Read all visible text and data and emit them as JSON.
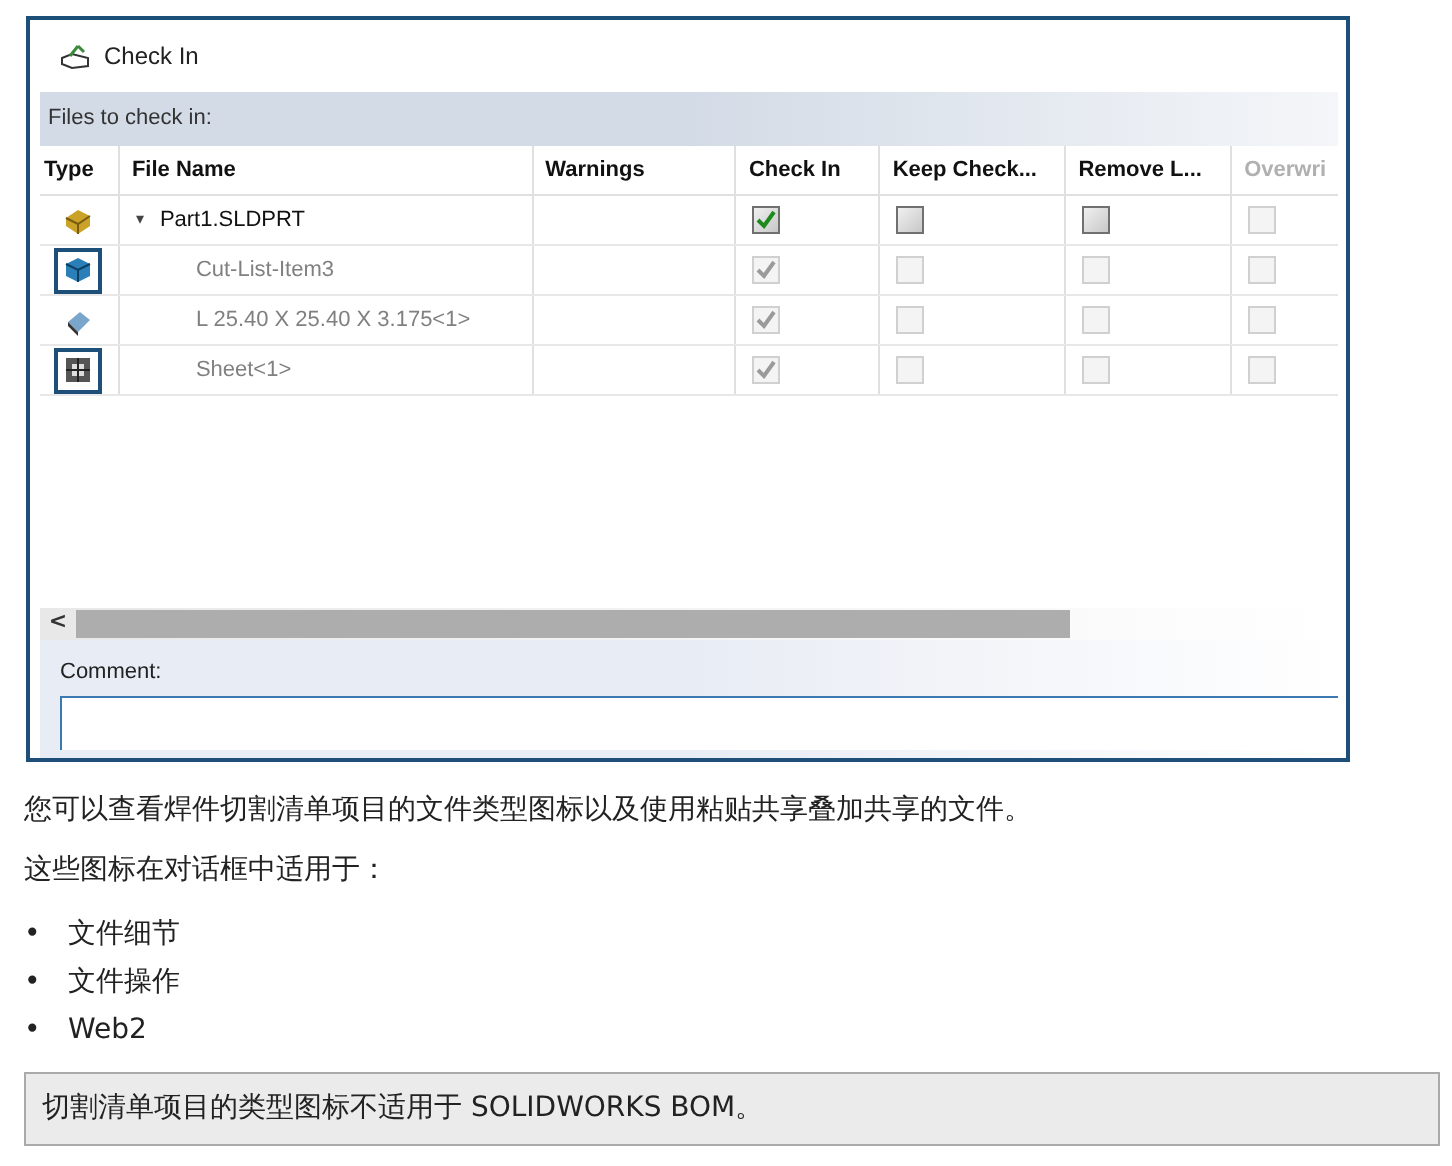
{
  "dialog": {
    "title": "Check In",
    "section_label": "Files to check in:",
    "columns": [
      {
        "label": "Type",
        "disabled": false
      },
      {
        "label": "File Name",
        "disabled": false
      },
      {
        "label": "Warnings",
        "disabled": false
      },
      {
        "label": "Check In",
        "disabled": false
      },
      {
        "label": "Keep Check...",
        "disabled": false
      },
      {
        "label": "Remove L...",
        "disabled": false
      },
      {
        "label": "Overwri",
        "disabled": true
      }
    ],
    "rows": [
      {
        "kind": "part",
        "name": "Part1.SLDPRT",
        "highlighted": false,
        "expanded": true,
        "disabled": false,
        "check_in": {
          "checked": true,
          "disabled": false
        },
        "keep_checked_out": {
          "checked": false,
          "disabled": false
        },
        "remove_local": {
          "checked": false,
          "disabled": false
        },
        "overwrite": {
          "checked": false,
          "disabled": true
        },
        "children": [
          {
            "kind": "cut-list",
            "name": "Cut-List-Item3",
            "highlighted": true,
            "disabled": true,
            "check_in": {
              "checked": true,
              "disabled": true
            },
            "keep_checked_out": {
              "checked": false,
              "disabled": true
            },
            "remove_local": {
              "checked": false,
              "disabled": true
            },
            "overwrite": {
              "checked": false,
              "disabled": true
            }
          },
          {
            "kind": "body",
            "name": "L 25.40 X 25.40 X 3.175<1>",
            "highlighted": false,
            "disabled": true,
            "check_in": {
              "checked": true,
              "disabled": true
            },
            "keep_checked_out": {
              "checked": false,
              "disabled": true
            },
            "remove_local": {
              "checked": false,
              "disabled": true
            },
            "overwrite": {
              "checked": false,
              "disabled": true
            }
          },
          {
            "kind": "sheet-metal",
            "name": "Sheet<1>",
            "highlighted": true,
            "disabled": true,
            "check_in": {
              "checked": true,
              "disabled": true
            },
            "keep_checked_out": {
              "checked": false,
              "disabled": true
            },
            "remove_local": {
              "checked": false,
              "disabled": true
            },
            "overwrite": {
              "checked": false,
              "disabled": true
            }
          }
        ]
      }
    ],
    "scroll_left": "<",
    "comment_label": "Comment:",
    "expander": "▾"
  },
  "paragraphs": [
    "您可以查看焊件切割清单项目的文件类型图标以及使用粘贴共享叠加共享的文件。",
    "这些图标在对话框中适用于："
  ],
  "bullets": [
    "文件细节",
    "文件操作",
    "Web2"
  ],
  "bullet_mark": "•",
  "note": "切割清单项目的类型图标不适用于 SOLIDWORKS BOM。"
}
